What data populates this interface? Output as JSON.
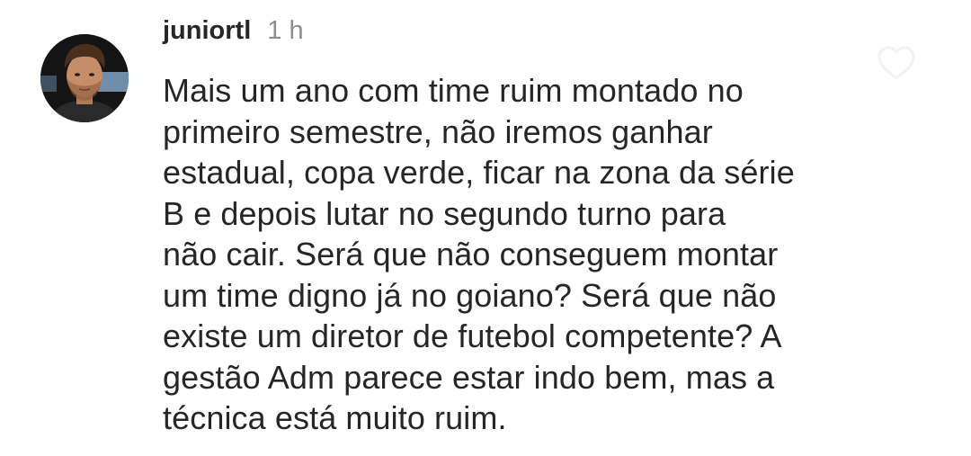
{
  "comment": {
    "username": "juniortl",
    "time": "1 h",
    "lines": [
      "Mais um ano com time ruim montado no",
      "primeiro semestre, não iremos ganhar",
      "estadual, copa verde, ficar na zona da série",
      "B e depois lutar no segundo turno para",
      "não cair. Será que não conseguem montar",
      "um time digno já no goiano? Será que não",
      "existe um diretor de futebol competente? A",
      "gestão Adm parece estar indo bem, mas a",
      "técnica está muito ruim."
    ],
    "like_icon": "heart-outline-icon"
  },
  "colors": {
    "text": "#262626",
    "muted": "#8e8e8e",
    "icon_outline": "#f2f2f2"
  }
}
